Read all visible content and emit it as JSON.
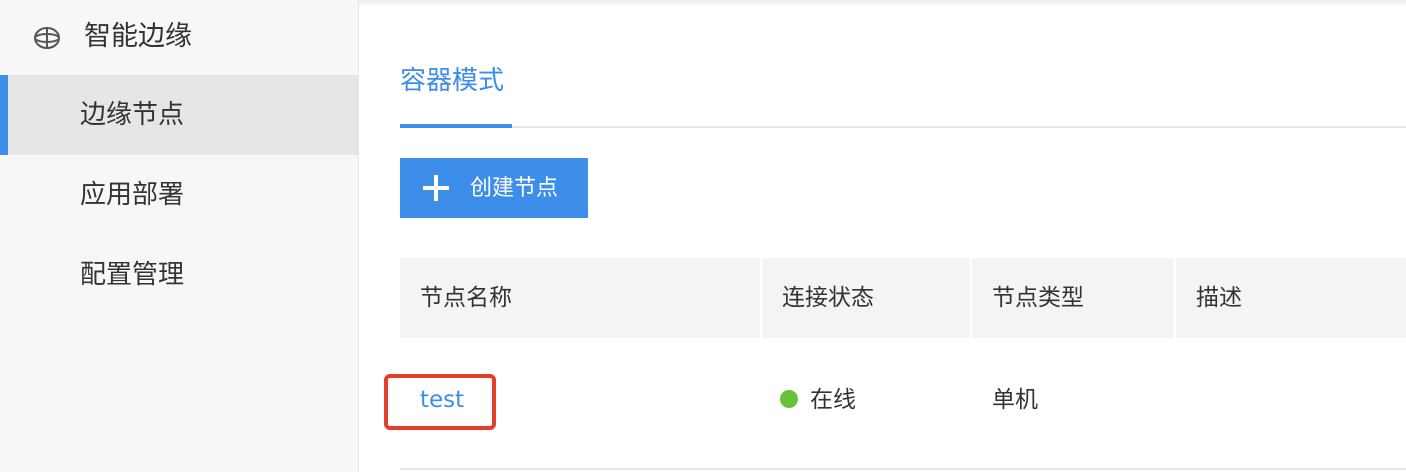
{
  "sidebar": {
    "group_title": "智能边缘",
    "items": [
      {
        "label": "边缘节点",
        "active": true
      },
      {
        "label": "应用部署",
        "active": false
      },
      {
        "label": "配置管理",
        "active": false
      }
    ]
  },
  "tabs": [
    {
      "label": "容器模式",
      "active": true
    }
  ],
  "toolbar": {
    "create_label": "创建节点"
  },
  "table": {
    "columns": [
      "节点名称",
      "连接状态",
      "节点类型",
      "描述"
    ],
    "rows": [
      {
        "name": "test",
        "status": "在线",
        "type": "单机",
        "description": ""
      }
    ]
  },
  "colors": {
    "accent": "#3d8ee8",
    "online": "#67c23a",
    "highlight": "#e43e2b"
  }
}
